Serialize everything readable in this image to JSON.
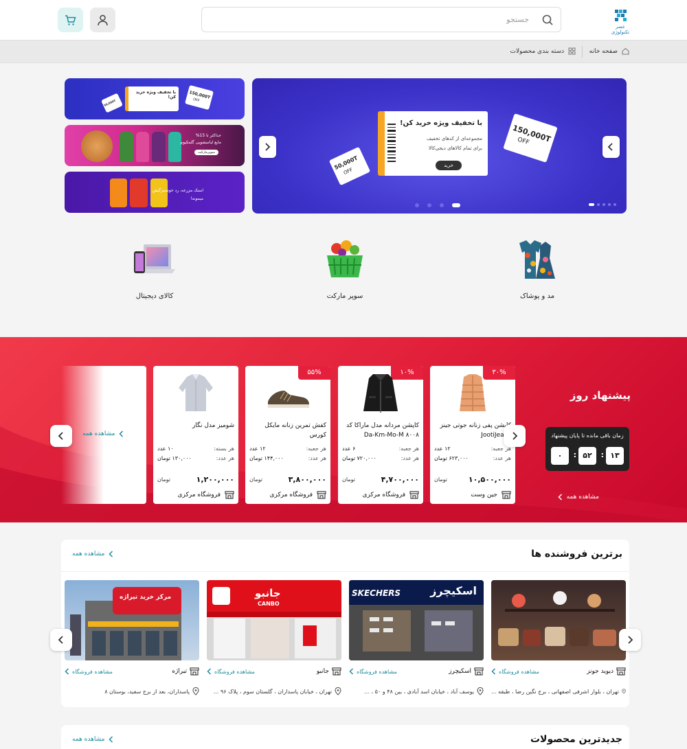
{
  "header": {
    "logo_text": "عصر تکنولوژی",
    "search_placeholder": "جستجو"
  },
  "breadcrumb": {
    "home": "صفحه خانه",
    "categories": "دسته بندی محصولات"
  },
  "hero": {
    "title": "با تخفیف ویژه خرید کن!",
    "line1": "مجموعه‌ای از کدهای تخفیف",
    "line2": "برای تمام کالاهای دیجی‌کالا",
    "button": "خرید",
    "coupon_big": "150,000T",
    "coupon_big_sub": "OFF",
    "coupon_small": "50,000T",
    "coupon_small_sub": "OFF",
    "dots_count": 4,
    "active_dot": 0
  },
  "side_banners": {
    "b1_text": "با تخفیف ویژه خرید کن!",
    "b1_coupon": "150,000T",
    "b1_coupon_sub": "OFF",
    "b1_coupon2": "50,000T",
    "b2_line1": "حداکثر تا 15%",
    "b2_line2": "مایع لباسشویی گلمکیوم",
    "b2_line3": "سوپرمارکت",
    "b3_line1": "اسنک مزرعه، رد خوشمزگیش",
    "b3_line2": "میمونه!"
  },
  "categories": [
    {
      "label": "مد و پوشاک",
      "icon": "clothing-icon"
    },
    {
      "label": "سوپر مارکت",
      "icon": "grocery-basket-icon"
    },
    {
      "label": "کالای دیجیتال",
      "icon": "laptop-phone-icon"
    }
  ],
  "deals": {
    "title": "پیشنهاد روز",
    "timer_label": "زمان باقی مانده تا پایان پیشنهاد",
    "hours": "۱۳",
    "minutes": "۵۲",
    "seconds": "۰",
    "see_all": "مشاهده همه",
    "see_all_left": "مشاهده همه",
    "products": [
      {
        "discount": "۳۰%",
        "name": "کاپشن پفی زنانه جوتی جینز JootiJeans",
        "unit_label": "هر جعبه:",
        "unit_value": "۱۲ عدد",
        "per_label": "هر عدد:",
        "per_value": "۶۲۳,۰۰۰ تومان",
        "price": "۱۰,۵۰۰,۰۰۰",
        "currency": "تومان",
        "store": "جین وست"
      },
      {
        "discount": "۱۰%",
        "name": "کاپشن مردانه مدل ماراکا کد Da-Km-Mo-M ۸۰۰۸",
        "unit_label": "هر جعبه:",
        "unit_value": "۶ عدد",
        "per_label": "هر عدد:",
        "per_value": "۷۲۰,۰۰۰ تومان",
        "price": "۴,۷۰۰,۰۰۰",
        "currency": "تومان",
        "store": "فروشگاه مرکزی"
      },
      {
        "discount": "۵۵%",
        "name": "کفش تمرین زنانه مایکل کورس",
        "unit_label": "هر جعبه:",
        "unit_value": "۱۲ عدد",
        "per_label": "هر عدد:",
        "per_value": "۱۴۴,۰۰۰ تومان",
        "price": "۳,۸۰۰,۰۰۰",
        "currency": "تومان",
        "store": "فروشگاه مرکزی"
      },
      {
        "discount": "",
        "name": "شومیز مدل نگار",
        "unit_label": "هر بسته:",
        "unit_value": "۱۰ عدد",
        "per_label": "هر عدد:",
        "per_value": "۱۳۰,۰۰۰ تومان",
        "price": "۱,۲۰۰,۰۰۰",
        "currency": "تومان",
        "store": "فروشگاه مرکزی"
      }
    ]
  },
  "sellers": {
    "title": "برترین فروشنده ها",
    "see_all": "مشاهده همه",
    "items": [
      {
        "name": "دیوید جونز",
        "link": "مشاهده فروشگاه",
        "address": "تهران ، بلوار اشرفی اصفهانی ، برج نگین رضا ، طبقه ..."
      },
      {
        "name": "اسکیچرز",
        "link": "مشاهده فروشگاه",
        "address": "یوسف آباد ، خیابان اسد آبادی ، بین ۴۸ و ۵۰ ، ...",
        "sign": "اسکیچرز",
        "sign_en": "SKECHERS"
      },
      {
        "name": "جانبو",
        "link": "مشاهده فروشگاه",
        "address": "تهران ، خیابان پاسداران ، گلستان سوم ، پلاک ۹۶ ...",
        "sign": "جانبو",
        "sign_en": "CANBO"
      },
      {
        "name": "تیراژه",
        "link": "مشاهده فروشگاه",
        "address": "پاسداران، بعد از برج سفید، بوستان ۸",
        "sign": "مرکز خرید تیراژه"
      }
    ]
  },
  "newest": {
    "title": "جدیدترین محصولات",
    "see_all": "مشاهده همه"
  },
  "colors": {
    "accent": "#1a8c9c",
    "deal_red": "#e2203a",
    "hero_blue": "#3c32c9"
  }
}
